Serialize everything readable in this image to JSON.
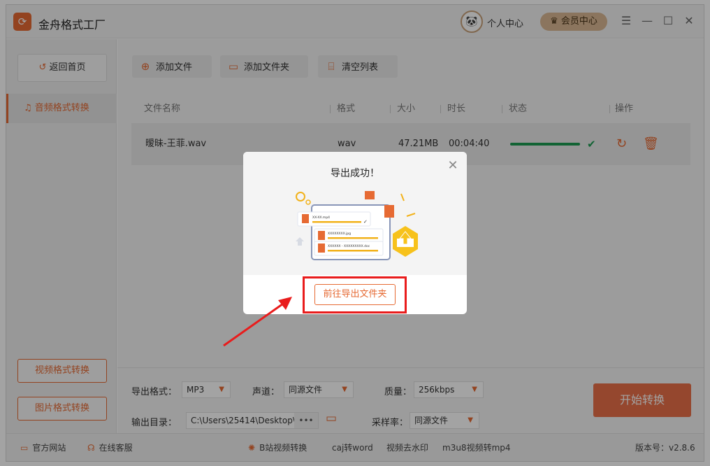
{
  "app": {
    "title": "金舟格式工厂",
    "logo_icon": "app-logo-icon"
  },
  "header": {
    "personal_center": "个人中心",
    "vip_center": "会员中心",
    "controls": {
      "menu": "☰",
      "minimize": "—",
      "maximize": "☐",
      "close": "✕"
    }
  },
  "sidebar": {
    "home": "返回首页",
    "active_item": "音频格式转换",
    "video_convert": "视频格式转换",
    "image_convert": "图片格式转换"
  },
  "toolbar": {
    "add_file": "添加文件",
    "add_folder": "添加文件夹",
    "clear_list": "清空列表"
  },
  "table": {
    "headers": [
      "文件名称",
      "格式",
      "大小",
      "时长",
      "状态",
      "操作"
    ],
    "rows": [
      {
        "name": "暧昧-王菲.wav",
        "format": "wav",
        "size": "47.21MB",
        "duration": "00:04:40",
        "status": "done"
      }
    ]
  },
  "bottom": {
    "export_format_label": "导出格式：",
    "export_format_value": "MP3",
    "channel_label": "声道：",
    "channel_value": "同源文件",
    "quality_label": "质量：",
    "quality_value": "256kbps",
    "output_dir_label": "输出目录：",
    "output_dir_value": "C:\\Users\\25414\\Desktop\\",
    "more": "•••",
    "sample_rate_label": "采样率：",
    "sample_rate_value": "同源文件",
    "start_button": "开始转换"
  },
  "statusbar": {
    "website": "官方网站",
    "service": "在线客服",
    "links": [
      "B站视频转换",
      "caj转word",
      "视频去水印",
      "m3u8视频转mp4"
    ],
    "version": "版本号：v2.8.6"
  },
  "modal": {
    "title": "导出成功！",
    "goto_folder": "前往导出文件夹",
    "files": [
      "XX-XX.mp4",
      "XXXXXXXX.jpg",
      "XXXXXX - XXXXXXXXX.doc"
    ]
  },
  "colors": {
    "accent": "#e66a33",
    "success": "#1d9b52",
    "highlight": "#e91c1c",
    "vip": "#d9b893"
  }
}
